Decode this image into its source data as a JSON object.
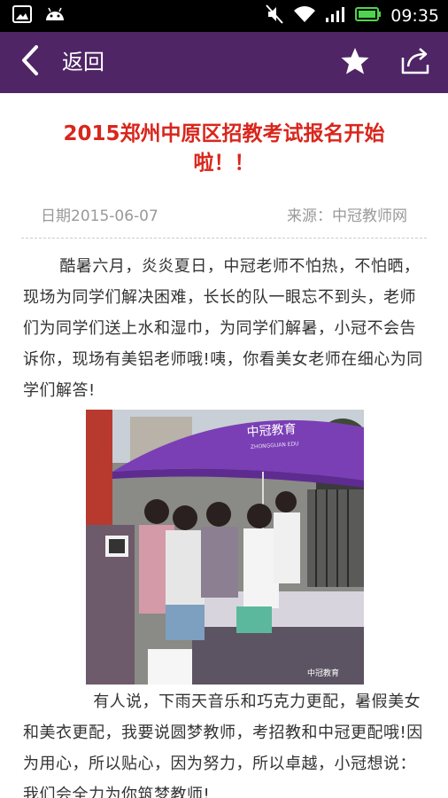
{
  "status_bar": {
    "time": "09:35",
    "icons": [
      "image-icon",
      "android-icon",
      "mute-icon",
      "wifi-icon",
      "signal-icon",
      "battery-icon"
    ]
  },
  "app_bar": {
    "back_label": "返回",
    "background": "#4f2566",
    "icons": [
      "back-arrow-icon",
      "star-icon",
      "share-icon"
    ]
  },
  "article": {
    "title": "2015郑州中原区招教考试报名开始啦！！",
    "title_color": "#d9261c",
    "date": "日期2015-06-07",
    "source": "来源：中冠教师网",
    "paragraph_1": "酷暑六月，炎炎夏日，中冠老师不怕热，不怕晒，现场为同学们解决困难，长长的队一眼忘不到头，老师们为同学们送上水和湿巾，为同学们解暑，小冠不会告诉你，现场有美铝老师哦!咦，你看美女老师在细心为同学们解答!",
    "photo": {
      "umbrella_text": "中冠教育",
      "umbrella_subtext": "ZHONGGUAN EDU",
      "watermark": "中冠教育"
    },
    "paragraph_2": "有人说，下雨天音乐和巧克力更配，暑假美女和美衣更配，我要说圆梦教师，考招教和中冠更配哦!因为用心，所以贴心，因为努力，所以卓越，小冠想说：我们会全力为你筑梦教师!"
  }
}
